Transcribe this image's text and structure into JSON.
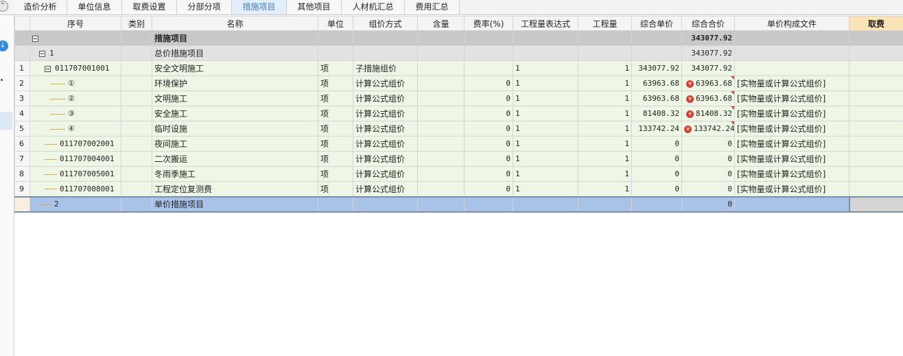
{
  "tabs": [
    {
      "label": "造价分析",
      "active": false
    },
    {
      "label": "单位信息",
      "active": false
    },
    {
      "label": "取费设置",
      "active": false
    },
    {
      "label": "分部分项",
      "active": false
    },
    {
      "label": "措施项目",
      "active": true
    },
    {
      "label": "其他项目",
      "active": false
    },
    {
      "label": "人材机汇总",
      "active": false
    },
    {
      "label": "费用汇总",
      "active": false
    }
  ],
  "columns": [
    "序号",
    "类别",
    "名称",
    "单位",
    "组价方式",
    "含量",
    "费率(%)",
    "工程量表达式",
    "工程量",
    "综合单价",
    "综合合价",
    "单价构成文件",
    "取费"
  ],
  "rows": [
    {
      "rownum": "",
      "code": "",
      "name": "措施项目",
      "unit": "",
      "method": "",
      "content": "",
      "rate": "",
      "expr": "",
      "qty": "",
      "price": "",
      "total": "343077.92",
      "file": "",
      "level": 0,
      "expander": true,
      "yen": false
    },
    {
      "rownum": "",
      "code": "1",
      "name": "总价措施项目",
      "unit": "",
      "method": "",
      "content": "",
      "rate": "",
      "expr": "",
      "qty": "",
      "price": "",
      "total": "343077.92",
      "file": "",
      "level": 1,
      "expander": true,
      "yen": false
    },
    {
      "rownum": "1",
      "code": "011707001001",
      "name": "安全文明施工",
      "unit": "项",
      "method": "子措施组价",
      "content": "",
      "rate": "",
      "expr": "1",
      "qty": "1",
      "price": "343077.92",
      "total": "343077.92",
      "file": "",
      "level": 2,
      "expander": true,
      "yen": false
    },
    {
      "rownum": "2",
      "code": "①",
      "name": "环境保护",
      "unit": "项",
      "method": "计算公式组价",
      "content": "",
      "rate": "0",
      "expr": "1",
      "qty": "1",
      "price": "63963.68",
      "total": "63963.68",
      "file": "[实物量或计算公式组价]",
      "level": 3,
      "expander": false,
      "yen": true
    },
    {
      "rownum": "3",
      "code": "②",
      "name": "文明施工",
      "unit": "项",
      "method": "计算公式组价",
      "content": "",
      "rate": "0",
      "expr": "1",
      "qty": "1",
      "price": "63963.68",
      "total": "63963.68",
      "file": "[实物量或计算公式组价]",
      "level": 3,
      "expander": false,
      "yen": true
    },
    {
      "rownum": "4",
      "code": "③",
      "name": "安全施工",
      "unit": "项",
      "method": "计算公式组价",
      "content": "",
      "rate": "0",
      "expr": "1",
      "qty": "1",
      "price": "81408.32",
      "total": "81408.32",
      "file": "[实物量或计算公式组价]",
      "level": 3,
      "expander": false,
      "yen": true
    },
    {
      "rownum": "5",
      "code": "④",
      "name": "临时设施",
      "unit": "项",
      "method": "计算公式组价",
      "content": "",
      "rate": "0",
      "expr": "1",
      "qty": "1",
      "price": "133742.24",
      "total": "133742.24",
      "file": "[实物量或计算公式组价]",
      "level": 3,
      "expander": false,
      "yen": true
    },
    {
      "rownum": "6",
      "code": "011707002001",
      "name": "夜间施工",
      "unit": "项",
      "method": "计算公式组价",
      "content": "",
      "rate": "0",
      "expr": "1",
      "qty": "1",
      "price": "0",
      "total": "0",
      "file": "[实物量或计算公式组价]",
      "level": 2,
      "expander": false,
      "yen": false
    },
    {
      "rownum": "7",
      "code": "011707004001",
      "name": "二次搬运",
      "unit": "项",
      "method": "计算公式组价",
      "content": "",
      "rate": "0",
      "expr": "1",
      "qty": "1",
      "price": "0",
      "total": "0",
      "file": "[实物量或计算公式组价]",
      "level": 2,
      "expander": false,
      "yen": false
    },
    {
      "rownum": "8",
      "code": "011707005001",
      "name": "冬雨季施工",
      "unit": "项",
      "method": "计算公式组价",
      "content": "",
      "rate": "0",
      "expr": "1",
      "qty": "1",
      "price": "0",
      "total": "0",
      "file": "[实物量或计算公式组价]",
      "level": 2,
      "expander": false,
      "yen": false
    },
    {
      "rownum": "9",
      "code": "011707008001",
      "name": "工程定位复测费",
      "unit": "项",
      "method": "计算公式组价",
      "content": "",
      "rate": "0",
      "expr": "1",
      "qty": "1",
      "price": "0",
      "total": "0",
      "file": "[实物量或计算公式组价]",
      "level": 2,
      "expander": false,
      "yen": false
    },
    {
      "rownum": "",
      "code": "2",
      "name": "单价措施项目",
      "unit": "",
      "method": "",
      "content": "",
      "rate": "",
      "expr": "",
      "qty": "",
      "price": "",
      "total": "0",
      "file": "",
      "level": 1,
      "expander": false,
      "yen": false,
      "selected": true
    }
  ],
  "icons": {
    "collapse": "chevron-up-circle-icon",
    "download": "download-circle-icon",
    "yen": "yen-icon"
  },
  "colors": {
    "active_tab": "#3a7fd0",
    "row_green": "#eef7e6",
    "row_selected": "#a9c3e8",
    "yen_badge": "#e03a2f",
    "tree_line": "#e2a93d"
  }
}
